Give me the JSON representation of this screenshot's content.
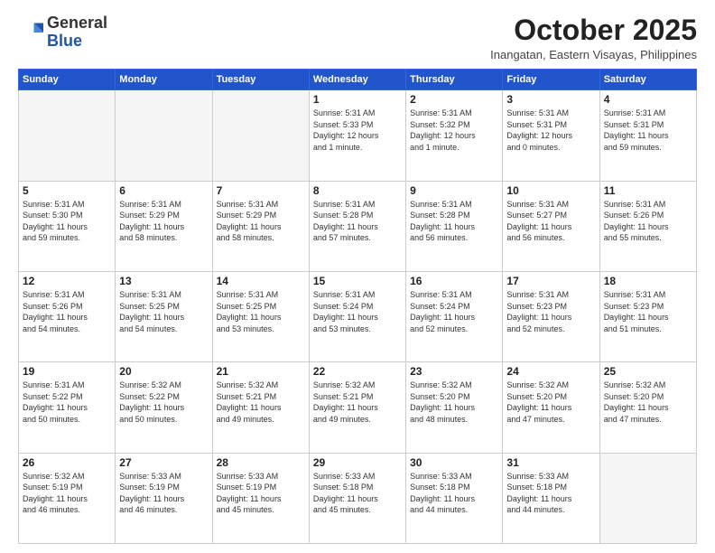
{
  "header": {
    "logo_general": "General",
    "logo_blue": "Blue",
    "month": "October 2025",
    "location": "Inangatan, Eastern Visayas, Philippines"
  },
  "days_of_week": [
    "Sunday",
    "Monday",
    "Tuesday",
    "Wednesday",
    "Thursday",
    "Friday",
    "Saturday"
  ],
  "weeks": [
    [
      {
        "day": "",
        "info": ""
      },
      {
        "day": "",
        "info": ""
      },
      {
        "day": "",
        "info": ""
      },
      {
        "day": "1",
        "info": "Sunrise: 5:31 AM\nSunset: 5:33 PM\nDaylight: 12 hours\nand 1 minute."
      },
      {
        "day": "2",
        "info": "Sunrise: 5:31 AM\nSunset: 5:32 PM\nDaylight: 12 hours\nand 1 minute."
      },
      {
        "day": "3",
        "info": "Sunrise: 5:31 AM\nSunset: 5:31 PM\nDaylight: 12 hours\nand 0 minutes."
      },
      {
        "day": "4",
        "info": "Sunrise: 5:31 AM\nSunset: 5:31 PM\nDaylight: 11 hours\nand 59 minutes."
      }
    ],
    [
      {
        "day": "5",
        "info": "Sunrise: 5:31 AM\nSunset: 5:30 PM\nDaylight: 11 hours\nand 59 minutes."
      },
      {
        "day": "6",
        "info": "Sunrise: 5:31 AM\nSunset: 5:29 PM\nDaylight: 11 hours\nand 58 minutes."
      },
      {
        "day": "7",
        "info": "Sunrise: 5:31 AM\nSunset: 5:29 PM\nDaylight: 11 hours\nand 58 minutes."
      },
      {
        "day": "8",
        "info": "Sunrise: 5:31 AM\nSunset: 5:28 PM\nDaylight: 11 hours\nand 57 minutes."
      },
      {
        "day": "9",
        "info": "Sunrise: 5:31 AM\nSunset: 5:28 PM\nDaylight: 11 hours\nand 56 minutes."
      },
      {
        "day": "10",
        "info": "Sunrise: 5:31 AM\nSunset: 5:27 PM\nDaylight: 11 hours\nand 56 minutes."
      },
      {
        "day": "11",
        "info": "Sunrise: 5:31 AM\nSunset: 5:26 PM\nDaylight: 11 hours\nand 55 minutes."
      }
    ],
    [
      {
        "day": "12",
        "info": "Sunrise: 5:31 AM\nSunset: 5:26 PM\nDaylight: 11 hours\nand 54 minutes."
      },
      {
        "day": "13",
        "info": "Sunrise: 5:31 AM\nSunset: 5:25 PM\nDaylight: 11 hours\nand 54 minutes."
      },
      {
        "day": "14",
        "info": "Sunrise: 5:31 AM\nSunset: 5:25 PM\nDaylight: 11 hours\nand 53 minutes."
      },
      {
        "day": "15",
        "info": "Sunrise: 5:31 AM\nSunset: 5:24 PM\nDaylight: 11 hours\nand 53 minutes."
      },
      {
        "day": "16",
        "info": "Sunrise: 5:31 AM\nSunset: 5:24 PM\nDaylight: 11 hours\nand 52 minutes."
      },
      {
        "day": "17",
        "info": "Sunrise: 5:31 AM\nSunset: 5:23 PM\nDaylight: 11 hours\nand 52 minutes."
      },
      {
        "day": "18",
        "info": "Sunrise: 5:31 AM\nSunset: 5:23 PM\nDaylight: 11 hours\nand 51 minutes."
      }
    ],
    [
      {
        "day": "19",
        "info": "Sunrise: 5:31 AM\nSunset: 5:22 PM\nDaylight: 11 hours\nand 50 minutes."
      },
      {
        "day": "20",
        "info": "Sunrise: 5:32 AM\nSunset: 5:22 PM\nDaylight: 11 hours\nand 50 minutes."
      },
      {
        "day": "21",
        "info": "Sunrise: 5:32 AM\nSunset: 5:21 PM\nDaylight: 11 hours\nand 49 minutes."
      },
      {
        "day": "22",
        "info": "Sunrise: 5:32 AM\nSunset: 5:21 PM\nDaylight: 11 hours\nand 49 minutes."
      },
      {
        "day": "23",
        "info": "Sunrise: 5:32 AM\nSunset: 5:20 PM\nDaylight: 11 hours\nand 48 minutes."
      },
      {
        "day": "24",
        "info": "Sunrise: 5:32 AM\nSunset: 5:20 PM\nDaylight: 11 hours\nand 47 minutes."
      },
      {
        "day": "25",
        "info": "Sunrise: 5:32 AM\nSunset: 5:20 PM\nDaylight: 11 hours\nand 47 minutes."
      }
    ],
    [
      {
        "day": "26",
        "info": "Sunrise: 5:32 AM\nSunset: 5:19 PM\nDaylight: 11 hours\nand 46 minutes."
      },
      {
        "day": "27",
        "info": "Sunrise: 5:33 AM\nSunset: 5:19 PM\nDaylight: 11 hours\nand 46 minutes."
      },
      {
        "day": "28",
        "info": "Sunrise: 5:33 AM\nSunset: 5:19 PM\nDaylight: 11 hours\nand 45 minutes."
      },
      {
        "day": "29",
        "info": "Sunrise: 5:33 AM\nSunset: 5:18 PM\nDaylight: 11 hours\nand 45 minutes."
      },
      {
        "day": "30",
        "info": "Sunrise: 5:33 AM\nSunset: 5:18 PM\nDaylight: 11 hours\nand 44 minutes."
      },
      {
        "day": "31",
        "info": "Sunrise: 5:33 AM\nSunset: 5:18 PM\nDaylight: 11 hours\nand 44 minutes."
      },
      {
        "day": "",
        "info": ""
      }
    ]
  ]
}
